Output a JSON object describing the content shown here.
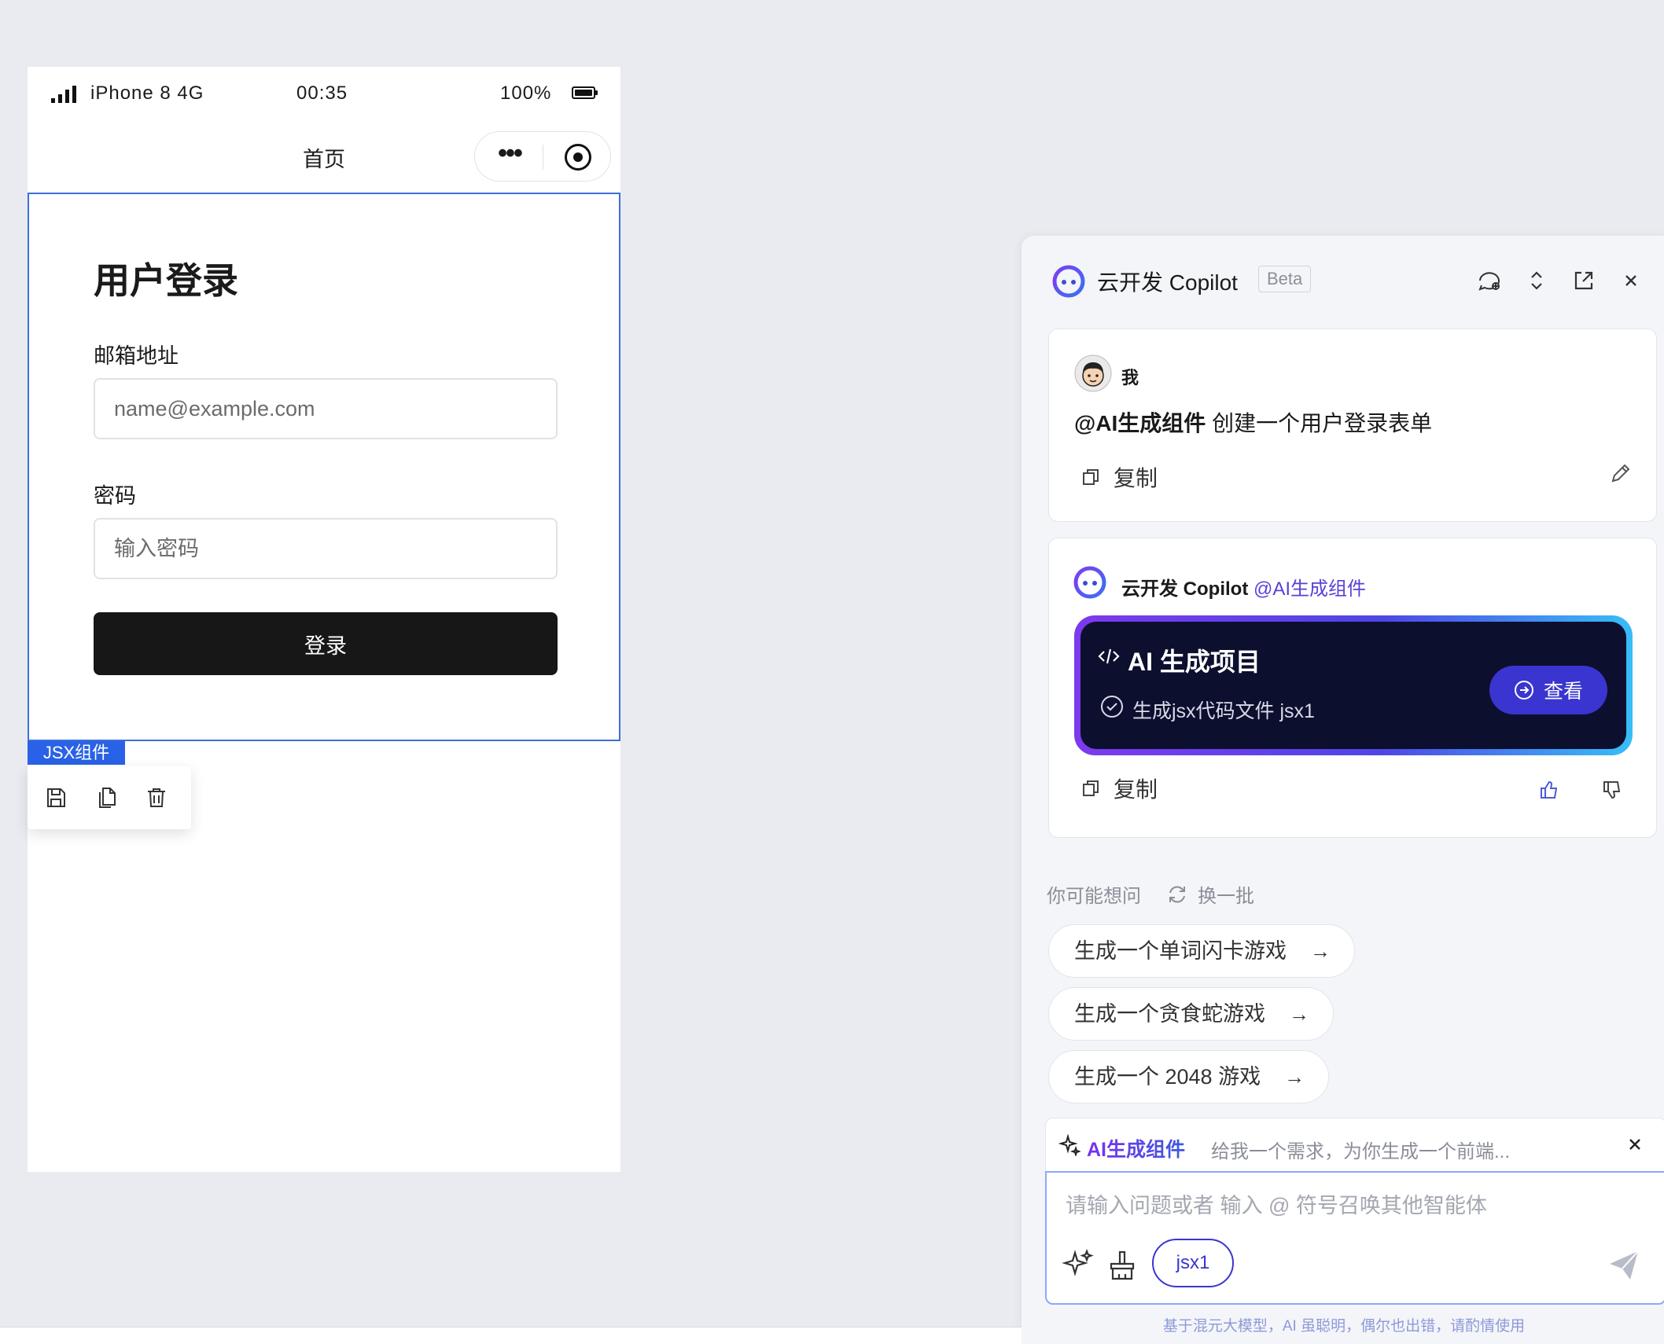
{
  "status_bar": {
    "carrier": "iPhone 8  4G",
    "time": "00:35",
    "battery": "100%"
  },
  "nav": {
    "title": "首页"
  },
  "form": {
    "title": "用户登录",
    "email_label": "邮箱地址",
    "email_placeholder": "name@example.com",
    "password_label": "密码",
    "password_placeholder": "输入密码",
    "submit_label": "登录"
  },
  "component": {
    "tag": "JSX组件"
  },
  "copilot": {
    "title": "云开发 Copilot",
    "badge": "Beta",
    "user_message": {
      "name": "我",
      "mention": "@AI生成组件",
      "text": " 创建一个用户登录表单",
      "copy_label": "复制"
    },
    "bot_message": {
      "name": "云开发 Copilot",
      "mention": "@AI生成组件",
      "project_title": "AI 生成项目",
      "file_status": "生成jsx代码文件 jsx1",
      "view_label": "查看",
      "copy_label": "复制"
    },
    "suggestions": {
      "heading": "你可能想问",
      "refresh_label": "换一批",
      "items": [
        "生成一个单词闪卡游戏",
        "生成一个贪食蛇游戏",
        "生成一个 2048 游戏"
      ]
    },
    "agent": {
      "name": "AI生成组件",
      "description": "给我一个需求，为你生成一个前端..."
    },
    "input": {
      "placeholder": "请输入问题或者 输入 @ 符号召唤其他智能体",
      "context_chip": "jsx1"
    },
    "disclaimer": "基于混元大模型，AI 虽聪明，偶尔也出错，请酌情使用"
  },
  "colors": {
    "accent": "#3a35d0",
    "selection": "#3b6fd9",
    "gradient_start": "#7c3aed",
    "gradient_end": "#38bdf8",
    "dark_card": "#0c0f2e"
  }
}
